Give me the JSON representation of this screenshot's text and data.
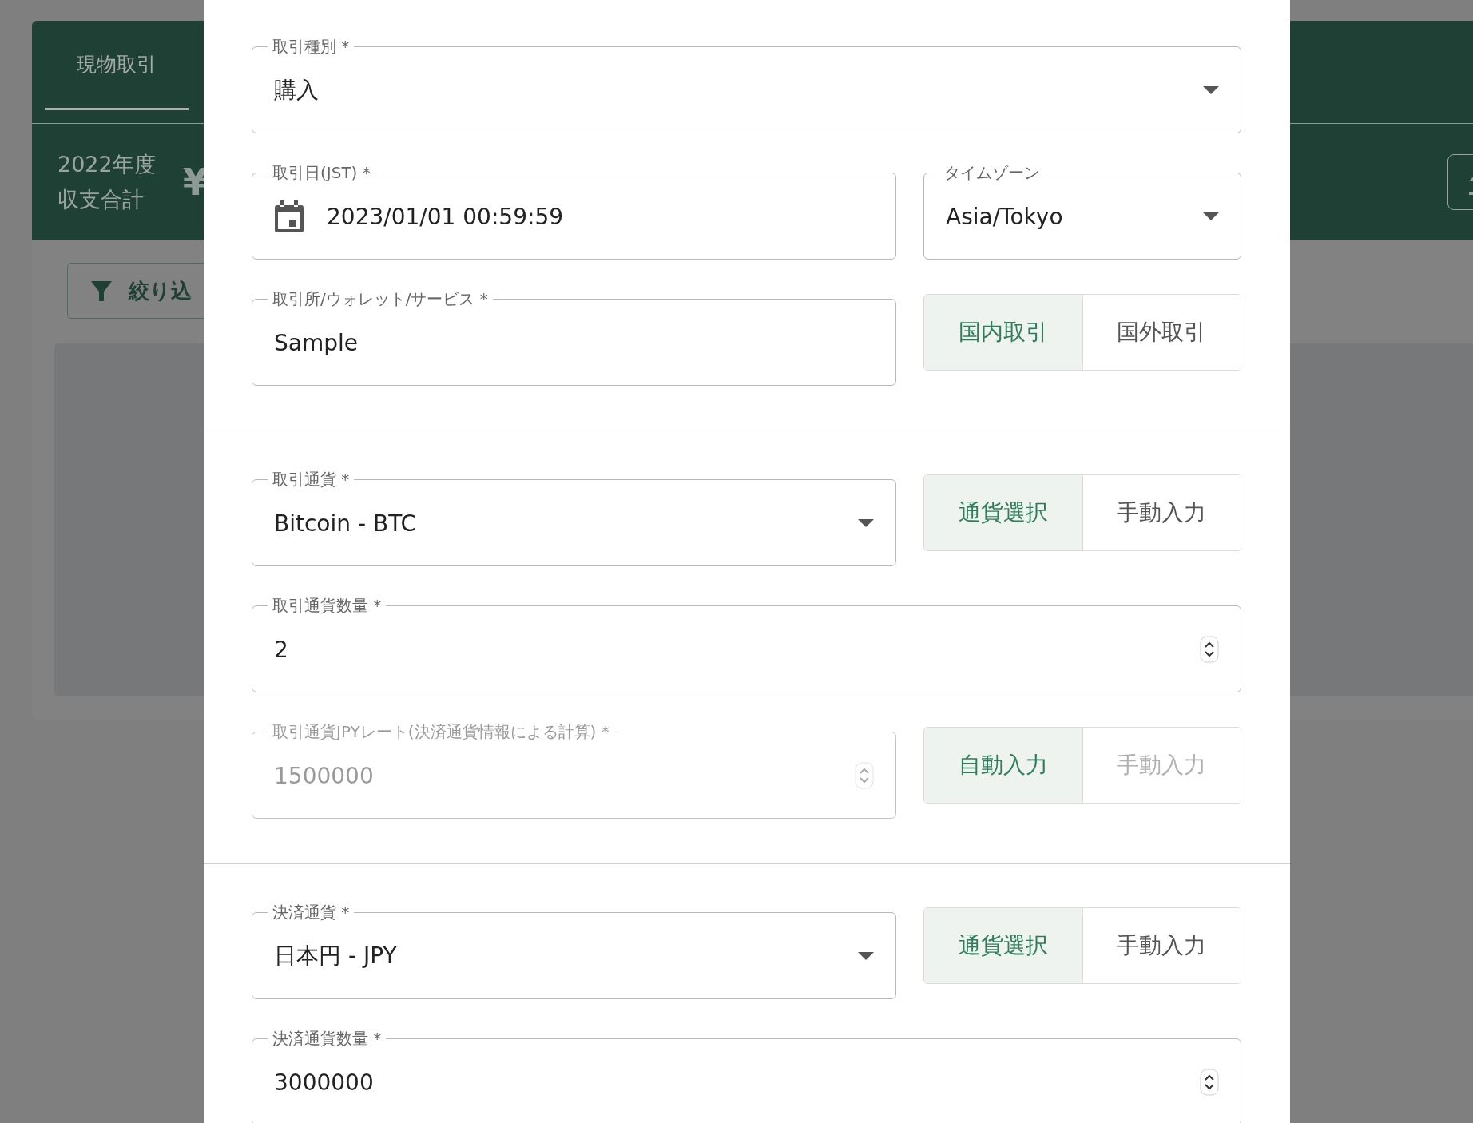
{
  "background": {
    "tabs": [
      {
        "label": "現物取引",
        "selected": true
      }
    ],
    "summary_label": [
      "2022年度",
      "収支合計"
    ],
    "summary_amount": "¥",
    "filter_button": "絞り込"
  },
  "dialog": {
    "sections": [
      {
        "rows": [
          {
            "fields": [
              {
                "kind": "select",
                "label": "取引種別 *",
                "value": "購入",
                "disabled": false
              }
            ]
          },
          {
            "fields": [
              {
                "kind": "date",
                "label": "取引日(JST) *",
                "value": "2023/01/01 00:59:59",
                "disabled": false
              },
              {
                "kind": "select",
                "label": "タイムゾーン",
                "value": "Asia/Tokyo",
                "disabled": false
              }
            ]
          },
          {
            "fields": [
              {
                "kind": "text",
                "label": "取引所/ウォレット/サービス *",
                "value": "Sample",
                "disabled": false
              }
            ],
            "toggle": [
              {
                "label": "国内取引",
                "selected": true,
                "disabled": false
              },
              {
                "label": "国外取引",
                "selected": false,
                "disabled": false
              }
            ]
          }
        ]
      },
      {
        "rows": [
          {
            "fields": [
              {
                "kind": "select",
                "label": "取引通貨 *",
                "value": "Bitcoin - BTC",
                "disabled": false
              }
            ],
            "toggle": [
              {
                "label": "通貨選択",
                "selected": true,
                "disabled": false
              },
              {
                "label": "手動入力",
                "selected": false,
                "disabled": false
              }
            ]
          },
          {
            "fields": [
              {
                "kind": "number",
                "label": "取引通貨数量 *",
                "value": "2",
                "disabled": false
              }
            ]
          },
          {
            "fields": [
              {
                "kind": "number",
                "label": "取引通貨JPYレート(決済通貨情報による計算) *",
                "value": "1500000",
                "disabled": true
              }
            ],
            "toggle": [
              {
                "label": "自動入力",
                "selected": true,
                "disabled": false
              },
              {
                "label": "手動入力",
                "selected": false,
                "disabled": true
              }
            ]
          }
        ]
      },
      {
        "rows": [
          {
            "fields": [
              {
                "kind": "select",
                "label": "決済通貨 *",
                "value": "日本円 - JPY",
                "disabled": false
              }
            ],
            "toggle": [
              {
                "label": "通貨選択",
                "selected": true,
                "disabled": false
              },
              {
                "label": "手動入力",
                "selected": false,
                "disabled": false
              }
            ]
          },
          {
            "fields": [
              {
                "kind": "number",
                "label": "決済通貨数量 *",
                "value": "3000000",
                "disabled": false
              }
            ]
          }
        ]
      }
    ]
  }
}
